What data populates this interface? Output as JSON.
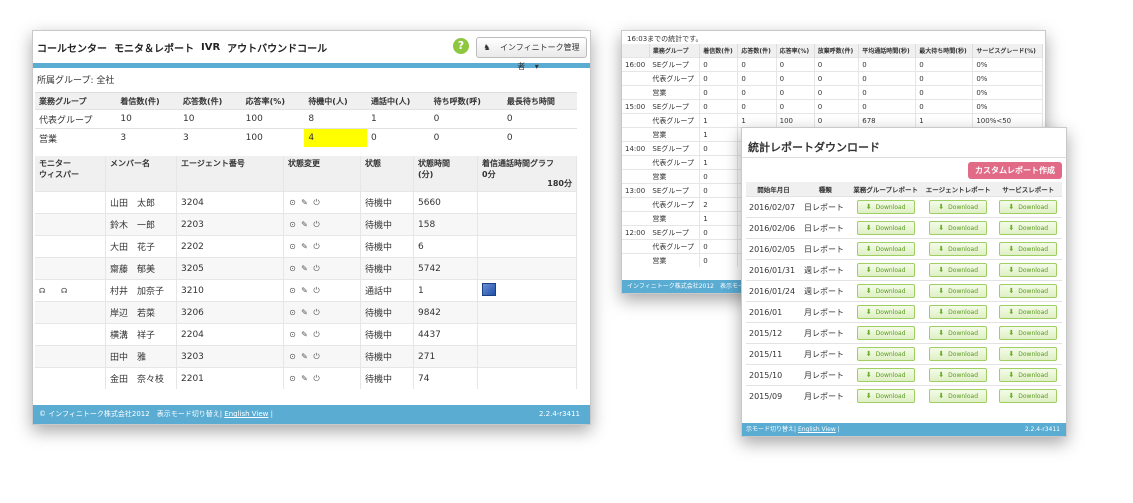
{
  "main": {
    "nav": [
      "コールセンター",
      "モニタ＆レポート",
      "IVR",
      "アウトバウンドコール"
    ],
    "help": "?",
    "user_button": "インフィニトーク管理者",
    "group_label": "所属グループ: 全社",
    "summary_headers": [
      "業務グループ",
      "着信数(件)",
      "応答数(件)",
      "応答率(%)",
      "待機中(人)",
      "通話中(人)",
      "待ち呼数(呼)",
      "最長待ち時間"
    ],
    "summary_rows": [
      [
        "代表グループ",
        "10",
        "10",
        "100",
        "8",
        "1",
        "0",
        "0"
      ],
      [
        "営業",
        "3",
        "3",
        "100",
        "4",
        "0",
        "0",
        "0"
      ]
    ],
    "agent_headers": [
      "モニター\nウィスパー",
      "メンバー名",
      "エージェント番号",
      "状態変更",
      "状態",
      "状態時間\n(分)",
      "着信通話時間グラフ\n0分"
    ],
    "graph_max": "180分",
    "agents": [
      [
        "",
        "山田　太郎",
        "3204",
        "待機中",
        "5660"
      ],
      [
        "",
        "鈴木　一郎",
        "2203",
        "待機中",
        "158"
      ],
      [
        "",
        "大田　花子",
        "2202",
        "待機中",
        "6"
      ],
      [
        "",
        "齋藤　郁美",
        "3205",
        "待機中",
        "5742"
      ],
      [
        "monitor",
        "村井　加奈子",
        "3210",
        "通話中",
        "1"
      ],
      [
        "",
        "岸辺　若菜",
        "3206",
        "待機中",
        "9842"
      ],
      [
        "",
        "横溝　祥子",
        "2204",
        "待機中",
        "4437"
      ],
      [
        "",
        "田中　雅",
        "3203",
        "待機中",
        "271"
      ],
      [
        "",
        "金田　奈々枝",
        "2201",
        "待機中",
        "74"
      ]
    ],
    "footer_left": "© インフィニトーク株式会社2012　表示モード切り替え|",
    "footer_link": "English View",
    "footer_sep": "|",
    "version": "2.2.4-r3411"
  },
  "stats": {
    "note": "16:03までの統計です。",
    "headers": [
      "",
      "業務グループ",
      "着信数(件)",
      "応答数(件)",
      "応答率(%)",
      "放棄呼数(件)",
      "平均通話時間(秒)",
      "最大待ち時間(秒)",
      "サービスグレード(%)"
    ],
    "rows": [
      [
        "16:00",
        "SEグループ",
        "0",
        "0",
        "0",
        "0",
        "0",
        "0",
        "0%"
      ],
      [
        "",
        "代表グループ",
        "0",
        "0",
        "0",
        "0",
        "0",
        "0",
        "0%"
      ],
      [
        "",
        "営業",
        "0",
        "0",
        "0",
        "0",
        "0",
        "0",
        "0%"
      ],
      [
        "15:00",
        "SEグループ",
        "0",
        "0",
        "0",
        "0",
        "0",
        "0",
        "0%"
      ],
      [
        "",
        "代表グループ",
        "1",
        "1",
        "100",
        "0",
        "678",
        "1",
        "100%<50"
      ],
      [
        "",
        "営業",
        "1",
        "",
        "",
        "",
        "",
        "",
        ""
      ],
      [
        "14:00",
        "SEグループ",
        "0",
        "",
        "",
        "",
        "",
        "",
        ""
      ],
      [
        "",
        "代表グループ",
        "1",
        "",
        "",
        "",
        "",
        "",
        ""
      ],
      [
        "",
        "営業",
        "0",
        "",
        "",
        "",
        "",
        "",
        ""
      ],
      [
        "13:00",
        "SEグループ",
        "0",
        "",
        "",
        "",
        "",
        "",
        ""
      ],
      [
        "",
        "代表グループ",
        "2",
        "",
        "",
        "",
        "",
        "",
        ""
      ],
      [
        "",
        "営業",
        "1",
        "",
        "",
        "",
        "",
        "",
        ""
      ],
      [
        "12:00",
        "SEグループ",
        "0",
        "",
        "",
        "",
        "",
        "",
        ""
      ],
      [
        "",
        "代表グループ",
        "0",
        "",
        "",
        "",
        "",
        "",
        ""
      ],
      [
        "",
        "営業",
        "0",
        "",
        "",
        "",
        "",
        "",
        ""
      ]
    ],
    "footer": "インフィニトーク株式会社2012　表示モード切り替"
  },
  "download": {
    "title": "統計レポートダウンロード",
    "custom_button": "カスタムレポート作成",
    "headers": [
      "開始年月日",
      "種類",
      "業務グループレポート",
      "エージェントレポート",
      "サービスレポート"
    ],
    "download_label": "Download",
    "rows": [
      [
        "2016/02/07",
        "日レポート"
      ],
      [
        "2016/02/06",
        "日レポート"
      ],
      [
        "2016/02/05",
        "日レポート"
      ],
      [
        "2016/01/31",
        "週レポート"
      ],
      [
        "2016/01/24",
        "週レポート"
      ],
      [
        "2016/01",
        "月レポート"
      ],
      [
        "2015/12",
        "月レポート"
      ],
      [
        "2015/11",
        "月レポート"
      ],
      [
        "2015/10",
        "月レポート"
      ],
      [
        "2015/09",
        "月レポート"
      ]
    ],
    "footer_left": "示モード切り替え|",
    "footer_link": "English View",
    "footer_sep": "|",
    "version": "2.2.4-r3411"
  },
  "colors": {
    "accent": "#5aacd3",
    "highlight": "#ffff00",
    "custom": "#e16a86",
    "download": "#8dc63f"
  }
}
